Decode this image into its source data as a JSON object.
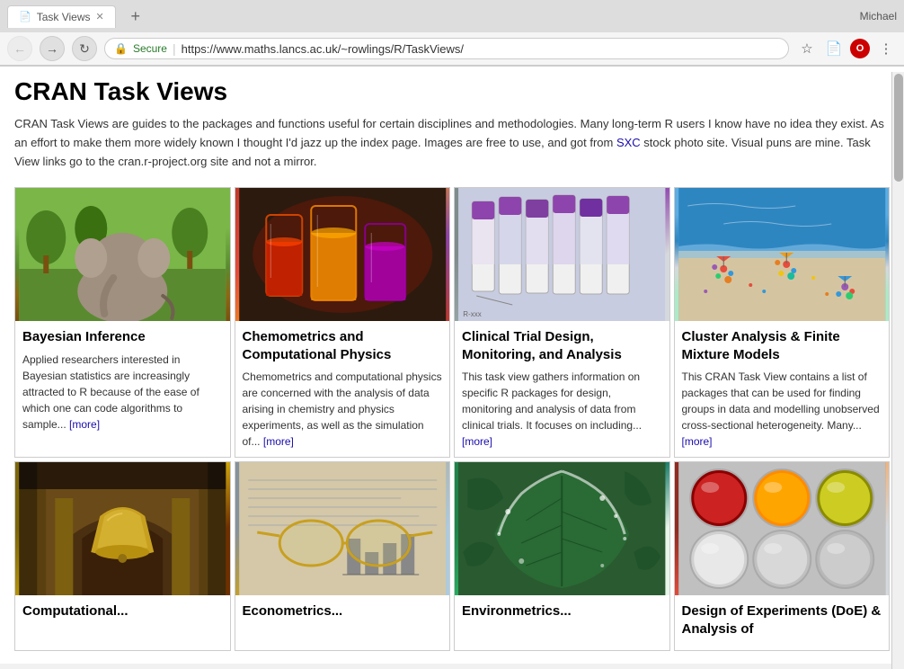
{
  "browser": {
    "tab_title": "Task Views",
    "tab_favicon": "📄",
    "address": "https://www.maths.lancs.ac.uk/~rowlings/R/TaskViews/",
    "address_display": "https://www.maths.lancs.ac.uk/~rowlings/R/TaskViews/",
    "secure_label": "Secure",
    "user_name": "Michael"
  },
  "page": {
    "title": "CRAN Task Views",
    "description_part1": "CRAN Task Views are guides to the packages and functions useful for certain disciplines and methodologies. Many long-term R users I know have no idea they exist. As an effort to make them more widely known I thought I'd jazz up the index page. Images are free to use, and got from ",
    "description_link_text": "SXC",
    "description_part2": " stock photo site. Visual puns are mine. Task View links go to the cran.r-project.org site and not a mirror."
  },
  "cards": [
    {
      "id": "bayesian-inference",
      "title": "Bayesian Inference",
      "image_type": "elephant",
      "text": "Applied researchers interested in Bayesian statistics are increasingly attracted to R because of the ease of which one can code algorithms to sample...",
      "more_label": "[more]",
      "more_href": "#"
    },
    {
      "id": "chemometrics",
      "title": "Chemometrics and Computational Physics",
      "image_type": "chemistry",
      "text": "Chemometrics and computational physics are concerned with the analysis of data arising in chemistry and physics experiments, as well as the simulation of...",
      "more_label": "[more]",
      "more_href": "#"
    },
    {
      "id": "clinical-trial",
      "title": "Clinical Trial Design, Monitoring, and Analysis",
      "image_type": "clinical",
      "text": "This task view gathers information on specific R packages for design, monitoring and analysis of data from clinical trials. It focuses on including...",
      "more_label": "[more]",
      "more_href": "#"
    },
    {
      "id": "cluster-analysis",
      "title": "Cluster Analysis & Finite Mixture Models",
      "image_type": "cluster",
      "text": "This CRAN Task View contains a list of packages that can be used for finding groups in data and modelling unobserved cross-sectional heterogeneity. Many...",
      "more_label": "[more]",
      "more_href": "#"
    },
    {
      "id": "computational-modal",
      "title": "Computational...",
      "image_type": "bell",
      "text": "",
      "more_label": "",
      "more_href": "#"
    },
    {
      "id": "econometrics",
      "title": "Econometrics...",
      "image_type": "glasses",
      "text": "",
      "more_label": "",
      "more_href": "#"
    },
    {
      "id": "environmetrics",
      "title": "Environmetrics...",
      "image_type": "leaf",
      "text": "",
      "more_label": "",
      "more_href": "#"
    },
    {
      "id": "doe",
      "title": "Design of Experiments (DoE) & Analysis of",
      "image_type": "doe",
      "text": "",
      "more_label": "",
      "more_href": "#"
    }
  ],
  "toolbar": {
    "back_label": "←",
    "forward_label": "→",
    "refresh_label": "↻",
    "menu_label": "⋮"
  }
}
